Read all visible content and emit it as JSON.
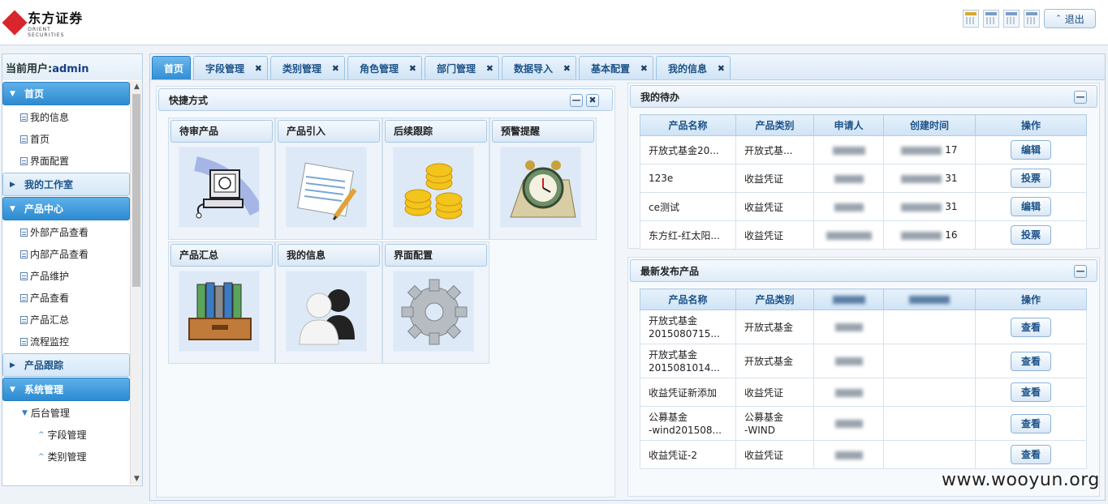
{
  "header": {
    "logo_cn": "东方证券",
    "logo_en": "ORIENT SECURITIES",
    "icons": [
      "calendar-yellow-icon",
      "calendar-icon",
      "calendar-icon",
      "calendar-icon"
    ],
    "logout_label": "退出"
  },
  "sidebar": {
    "user_prefix": "当前用户:",
    "username": "admin",
    "groups": {
      "home": {
        "label": "首页",
        "items": [
          "我的信息",
          "首页",
          "界面配置"
        ]
      },
      "studio": {
        "label": "我的工作室"
      },
      "product": {
        "label": "产品中心",
        "items": [
          "外部产品查看",
          "内部产品查看",
          "产品维护",
          "产品查看",
          "产品汇总",
          "流程监控"
        ]
      },
      "track": {
        "label": "产品跟踪"
      },
      "system": {
        "label": "系统管理",
        "sub": "后台管理",
        "items": [
          "字段管理",
          "类别管理"
        ]
      }
    }
  },
  "tabs": [
    "首页",
    "字段管理",
    "类别管理",
    "角色管理",
    "部门管理",
    "数据导入",
    "基本配置",
    "我的信息"
  ],
  "quick": {
    "title": "快捷方式",
    "tiles": [
      "待审产品",
      "产品引入",
      "后续跟踪",
      "预警提醒",
      "产品汇总",
      "我的信息",
      "界面配置"
    ]
  },
  "todo": {
    "title": "我的待办",
    "headers": [
      "产品名称",
      "产品类别",
      "申请人",
      "创建时间",
      "操作"
    ],
    "rows": [
      {
        "name": "开放式基金20...",
        "cat": "开放式基...",
        "time_tail": "17",
        "action": "编辑"
      },
      {
        "name": "123e",
        "cat": "收益凭证",
        "time_tail": "31",
        "action": "投票"
      },
      {
        "name": "ce测试",
        "cat": "收益凭证",
        "time_tail": "31",
        "action": "编辑"
      },
      {
        "name": "东方红-红太阳...",
        "cat": "收益凭证",
        "time_tail": "16",
        "action": "投票"
      }
    ]
  },
  "latest": {
    "title": "最新发布产品",
    "headers": [
      "产品名称",
      "产品类别",
      "",
      "",
      "操作"
    ],
    "rows": [
      {
        "name": "开放式基金\n2015080715...",
        "cat": "开放式基金",
        "action": "查看"
      },
      {
        "name": "开放式基金\n2015081014...",
        "cat": "开放式基金",
        "action": "查看"
      },
      {
        "name": "收益凭证新添加",
        "cat": "收益凭证",
        "action": "查看"
      },
      {
        "name": "公募基金\n-wind201508...",
        "cat": "公募基金\n-WIND",
        "action": "查看"
      },
      {
        "name": "收益凭证-2",
        "cat": "收益凭证",
        "action": "查看"
      }
    ]
  },
  "watermark": "www.wooyun.org"
}
